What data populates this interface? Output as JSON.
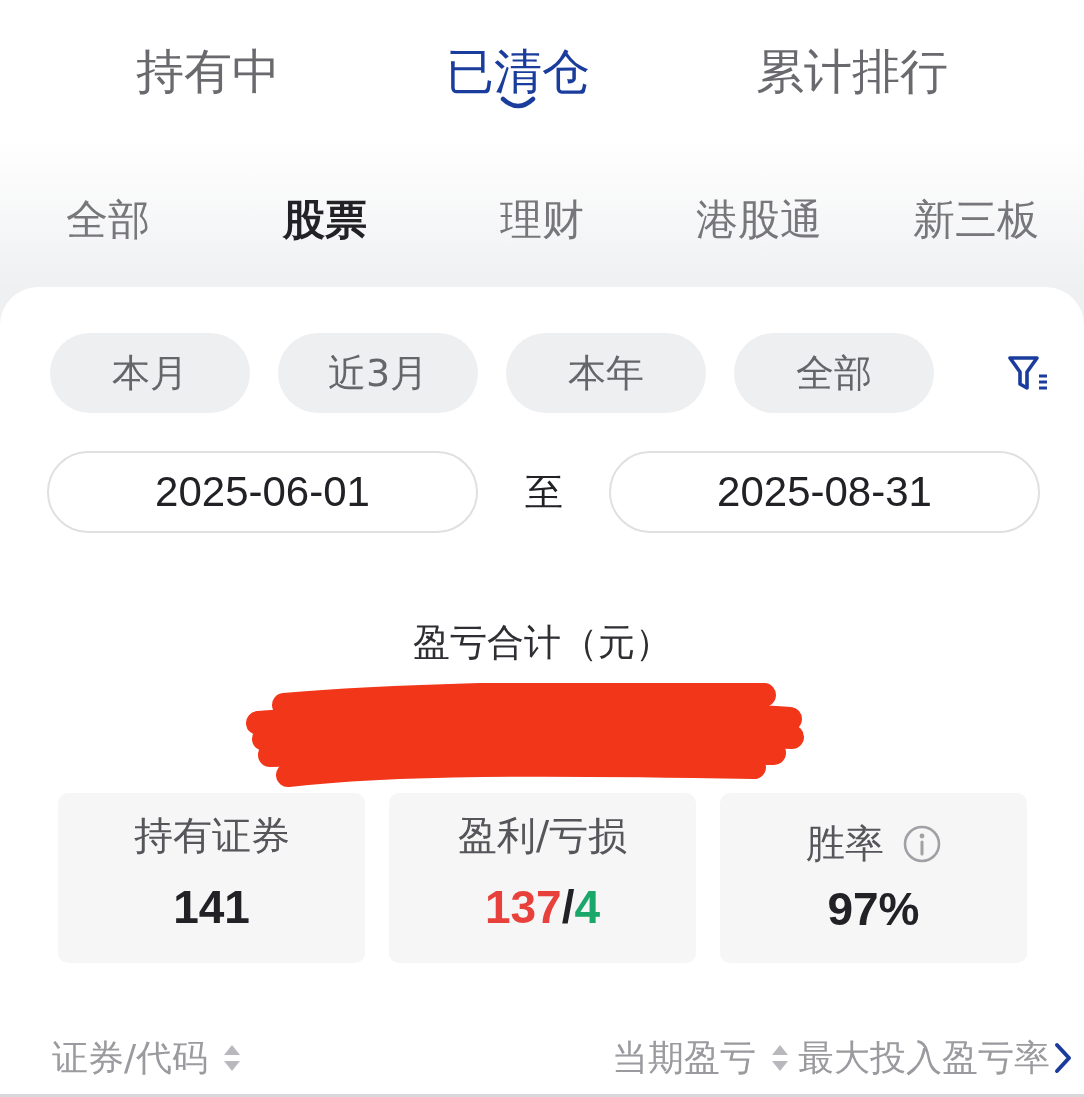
{
  "top_tabs": [
    {
      "label": "持有中",
      "selected": false
    },
    {
      "label": "已清仓",
      "selected": true
    },
    {
      "label": "累计排行",
      "selected": false
    }
  ],
  "category_tabs": [
    {
      "label": "全部",
      "selected": false
    },
    {
      "label": "股票",
      "selected": true
    },
    {
      "label": "理财",
      "selected": false
    },
    {
      "label": "港股通",
      "selected": false
    },
    {
      "label": "新三板",
      "selected": false
    }
  ],
  "period_filters": [
    {
      "label": "本月",
      "selected": false
    },
    {
      "label": "近3月",
      "selected": false
    },
    {
      "label": "本年",
      "selected": false
    },
    {
      "label": "全部",
      "selected": false
    }
  ],
  "date_range": {
    "start": "2025-06-01",
    "separator": "至",
    "end": "2025-08-31"
  },
  "summary": {
    "label": "盈亏合计（元）",
    "redacted": true
  },
  "stats": [
    {
      "kind": "plain",
      "label": "持有证券",
      "value": "141"
    },
    {
      "kind": "split",
      "label": "盈利/亏损",
      "gain": "137",
      "separator": "/",
      "loss": "4"
    },
    {
      "kind": "info",
      "label": "胜率",
      "value": "97%"
    }
  ],
  "columns": [
    {
      "label": "证券/代码",
      "sortable": true
    },
    {
      "label": "当期盈亏",
      "sortable": true
    },
    {
      "label": "最大投入盈亏率",
      "sortable": false
    }
  ]
}
